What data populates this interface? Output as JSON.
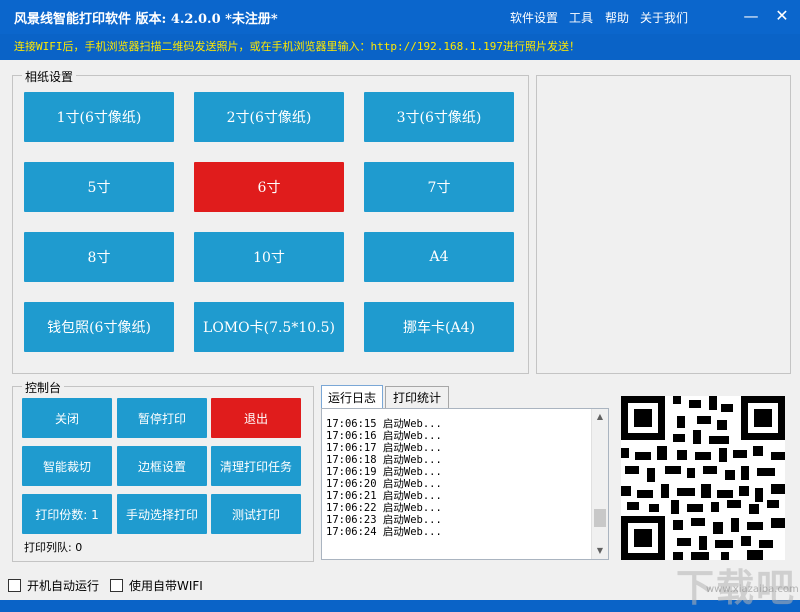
{
  "app": {
    "title": "风景线智能打印软件  版本: 4.2.0.0 *未注册*",
    "notice": "连接WIFI后，手机浏览器扫描二维码发送照片，或在手机浏览器里输入：http://192.168.1.197进行照片发送！"
  },
  "menu": {
    "settings": "软件设置",
    "tools": "工具",
    "help": "帮助",
    "about": "关于我们"
  },
  "window_controls": {
    "minimize": "—",
    "close": "✕"
  },
  "paper": {
    "group_label": "相纸设置",
    "buttons": [
      {
        "label": "1寸(6寸像纸)"
      },
      {
        "label": "2寸(6寸像纸)"
      },
      {
        "label": "3寸(6寸像纸)"
      },
      {
        "label": "5寸"
      },
      {
        "label": "6寸",
        "selected": true
      },
      {
        "label": "7寸"
      },
      {
        "label": "8寸"
      },
      {
        "label": "10寸"
      },
      {
        "label": "A4"
      },
      {
        "label": "钱包照(6寸像纸)"
      },
      {
        "label": "LOMO卡(7.5*10.5)"
      },
      {
        "label": "挪车卡(A4)"
      }
    ]
  },
  "control": {
    "group_label": "控制台",
    "buttons": [
      {
        "label": "关闭"
      },
      {
        "label": "暂停打印"
      },
      {
        "label": "退出",
        "danger": true
      },
      {
        "label": "智能裁切"
      },
      {
        "label": "边框设置"
      },
      {
        "label": "清理打印任务"
      },
      {
        "label": "打印份数: 1"
      },
      {
        "label": "手动选择打印"
      },
      {
        "label": "测试打印"
      }
    ],
    "queue": "打印列队: 0"
  },
  "tabs": [
    {
      "label": "运行日志",
      "active": true
    },
    {
      "label": "打印统计",
      "active": false
    }
  ],
  "log": [
    "17:06:15 启动Web...",
    "17:06:16 启动Web...",
    "17:06:17 启动Web...",
    "17:06:18 启动Web...",
    "17:06:19 启动Web...",
    "17:06:20 启动Web...",
    "17:06:21 启动Web...",
    "17:06:22 启动Web...",
    "17:06:23 启动Web...",
    "17:06:24 启动Web..."
  ],
  "footer": {
    "autostart": "开机自动运行",
    "wifi": "使用自带WIFI"
  },
  "watermark": {
    "text": "下载吧",
    "url": "www.xiazaiba.com"
  },
  "colors": {
    "accent": "#1f9bcf",
    "selected": "#e01c1c",
    "title_bar": "#0b66cc",
    "notice": "#ffe800"
  }
}
